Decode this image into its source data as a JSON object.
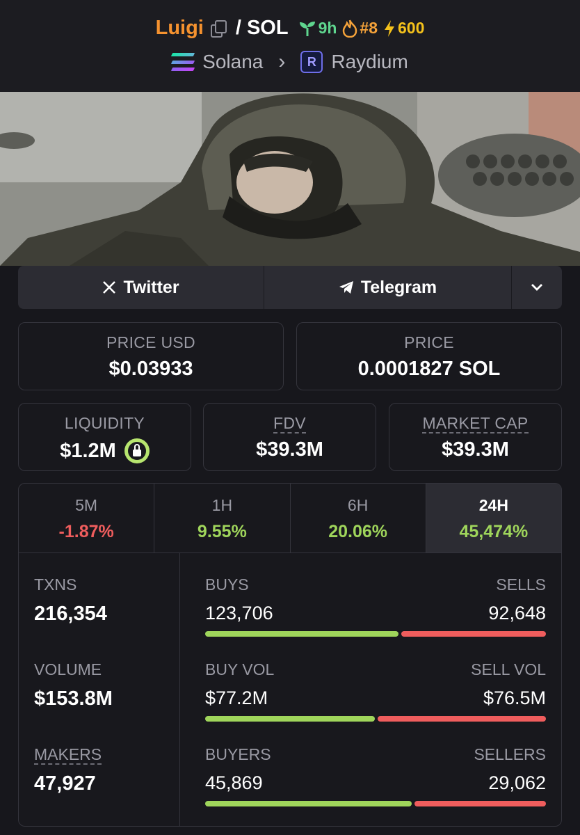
{
  "header": {
    "token_name": "Luigi",
    "separator": "/",
    "quote": "SOL",
    "age": "9h",
    "rank": "#8",
    "boost": "600",
    "chain": "Solana",
    "dex": "Raydium",
    "dex_logo_letter": "R"
  },
  "socials": {
    "twitter": "Twitter",
    "telegram": "Telegram"
  },
  "price": {
    "usd_label": "PRICE USD",
    "usd_value": "$0.03933",
    "native_label": "PRICE",
    "native_value": "0.0001827 SOL"
  },
  "metrics": {
    "liquidity_label": "LIQUIDITY",
    "liquidity_value": "$1.2M",
    "fdv_label": "FDV",
    "fdv_value": "$39.3M",
    "mcap_label": "MARKET CAP",
    "mcap_value": "$39.3M"
  },
  "timeframes": [
    {
      "label": "5M",
      "change": "-1.87%"
    },
    {
      "label": "1H",
      "change": "9.55%"
    },
    {
      "label": "6H",
      "change": "20.06%"
    },
    {
      "label": "24H",
      "change": "45,474%"
    }
  ],
  "summary": {
    "txns_label": "TXNS",
    "txns_value": "216,354",
    "volume_label": "VOLUME",
    "volume_value": "$153.8M",
    "makers_label": "MAKERS",
    "makers_value": "47,927"
  },
  "breakdown": {
    "buys_label": "BUYS",
    "sells_label": "SELLS",
    "buys": "123,706",
    "sells": "92,648",
    "buys_ratio": 0.572,
    "buyvol_label": "BUY VOL",
    "sellvol_label": "SELL VOL",
    "buy_vol": "$77.2M",
    "sell_vol": "$76.5M",
    "vol_ratio": 0.502,
    "buyers_label": "BUYERS",
    "sellers_label": "SELLERS",
    "buyers": "45,869",
    "sellers": "29,062",
    "buyers_ratio": 0.612
  },
  "colors": {
    "accent_orange": "#f5922f",
    "positive": "#9fd55b",
    "negative": "#ef5d5d"
  }
}
